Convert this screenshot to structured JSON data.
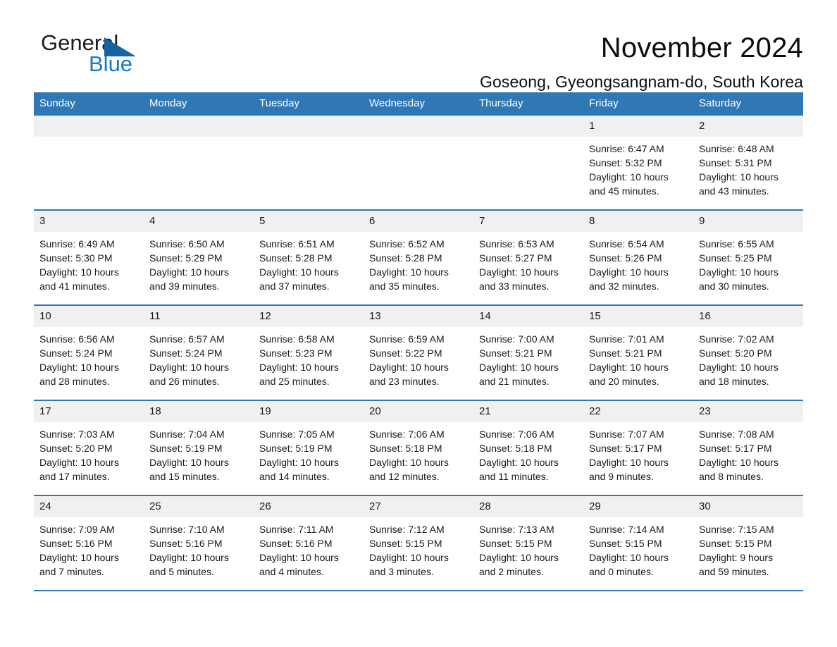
{
  "brand": {
    "name_part1": "General",
    "name_part2": "Blue",
    "triangle_color": "#1464a5",
    "blue_color": "#1479c4"
  },
  "header": {
    "title": "November 2024",
    "subtitle": "Goseong, Gyeongsangnam-do, South Korea"
  },
  "theme": {
    "header_blue": "#2f77b5",
    "daynum_band": "#f0f0f0",
    "row_divider": "#2f77b5"
  },
  "calendar": {
    "weekday_headers": [
      "Sunday",
      "Monday",
      "Tuesday",
      "Wednesday",
      "Thursday",
      "Friday",
      "Saturday"
    ],
    "weeks": [
      [
        {
          "day": "",
          "lines": []
        },
        {
          "day": "",
          "lines": []
        },
        {
          "day": "",
          "lines": []
        },
        {
          "day": "",
          "lines": []
        },
        {
          "day": "",
          "lines": []
        },
        {
          "day": "1",
          "lines": [
            "Sunrise: 6:47 AM",
            "Sunset: 5:32 PM",
            "Daylight: 10 hours",
            "and 45 minutes."
          ]
        },
        {
          "day": "2",
          "lines": [
            "Sunrise: 6:48 AM",
            "Sunset: 5:31 PM",
            "Daylight: 10 hours",
            "and 43 minutes."
          ]
        }
      ],
      [
        {
          "day": "3",
          "lines": [
            "Sunrise: 6:49 AM",
            "Sunset: 5:30 PM",
            "Daylight: 10 hours",
            "and 41 minutes."
          ]
        },
        {
          "day": "4",
          "lines": [
            "Sunrise: 6:50 AM",
            "Sunset: 5:29 PM",
            "Daylight: 10 hours",
            "and 39 minutes."
          ]
        },
        {
          "day": "5",
          "lines": [
            "Sunrise: 6:51 AM",
            "Sunset: 5:28 PM",
            "Daylight: 10 hours",
            "and 37 minutes."
          ]
        },
        {
          "day": "6",
          "lines": [
            "Sunrise: 6:52 AM",
            "Sunset: 5:28 PM",
            "Daylight: 10 hours",
            "and 35 minutes."
          ]
        },
        {
          "day": "7",
          "lines": [
            "Sunrise: 6:53 AM",
            "Sunset: 5:27 PM",
            "Daylight: 10 hours",
            "and 33 minutes."
          ]
        },
        {
          "day": "8",
          "lines": [
            "Sunrise: 6:54 AM",
            "Sunset: 5:26 PM",
            "Daylight: 10 hours",
            "and 32 minutes."
          ]
        },
        {
          "day": "9",
          "lines": [
            "Sunrise: 6:55 AM",
            "Sunset: 5:25 PM",
            "Daylight: 10 hours",
            "and 30 minutes."
          ]
        }
      ],
      [
        {
          "day": "10",
          "lines": [
            "Sunrise: 6:56 AM",
            "Sunset: 5:24 PM",
            "Daylight: 10 hours",
            "and 28 minutes."
          ]
        },
        {
          "day": "11",
          "lines": [
            "Sunrise: 6:57 AM",
            "Sunset: 5:24 PM",
            "Daylight: 10 hours",
            "and 26 minutes."
          ]
        },
        {
          "day": "12",
          "lines": [
            "Sunrise: 6:58 AM",
            "Sunset: 5:23 PM",
            "Daylight: 10 hours",
            "and 25 minutes."
          ]
        },
        {
          "day": "13",
          "lines": [
            "Sunrise: 6:59 AM",
            "Sunset: 5:22 PM",
            "Daylight: 10 hours",
            "and 23 minutes."
          ]
        },
        {
          "day": "14",
          "lines": [
            "Sunrise: 7:00 AM",
            "Sunset: 5:21 PM",
            "Daylight: 10 hours",
            "and 21 minutes."
          ]
        },
        {
          "day": "15",
          "lines": [
            "Sunrise: 7:01 AM",
            "Sunset: 5:21 PM",
            "Daylight: 10 hours",
            "and 20 minutes."
          ]
        },
        {
          "day": "16",
          "lines": [
            "Sunrise: 7:02 AM",
            "Sunset: 5:20 PM",
            "Daylight: 10 hours",
            "and 18 minutes."
          ]
        }
      ],
      [
        {
          "day": "17",
          "lines": [
            "Sunrise: 7:03 AM",
            "Sunset: 5:20 PM",
            "Daylight: 10 hours",
            "and 17 minutes."
          ]
        },
        {
          "day": "18",
          "lines": [
            "Sunrise: 7:04 AM",
            "Sunset: 5:19 PM",
            "Daylight: 10 hours",
            "and 15 minutes."
          ]
        },
        {
          "day": "19",
          "lines": [
            "Sunrise: 7:05 AM",
            "Sunset: 5:19 PM",
            "Daylight: 10 hours",
            "and 14 minutes."
          ]
        },
        {
          "day": "20",
          "lines": [
            "Sunrise: 7:06 AM",
            "Sunset: 5:18 PM",
            "Daylight: 10 hours",
            "and 12 minutes."
          ]
        },
        {
          "day": "21",
          "lines": [
            "Sunrise: 7:06 AM",
            "Sunset: 5:18 PM",
            "Daylight: 10 hours",
            "and 11 minutes."
          ]
        },
        {
          "day": "22",
          "lines": [
            "Sunrise: 7:07 AM",
            "Sunset: 5:17 PM",
            "Daylight: 10 hours",
            "and 9 minutes."
          ]
        },
        {
          "day": "23",
          "lines": [
            "Sunrise: 7:08 AM",
            "Sunset: 5:17 PM",
            "Daylight: 10 hours",
            "and 8 minutes."
          ]
        }
      ],
      [
        {
          "day": "24",
          "lines": [
            "Sunrise: 7:09 AM",
            "Sunset: 5:16 PM",
            "Daylight: 10 hours",
            "and 7 minutes."
          ]
        },
        {
          "day": "25",
          "lines": [
            "Sunrise: 7:10 AM",
            "Sunset: 5:16 PM",
            "Daylight: 10 hours",
            "and 5 minutes."
          ]
        },
        {
          "day": "26",
          "lines": [
            "Sunrise: 7:11 AM",
            "Sunset: 5:16 PM",
            "Daylight: 10 hours",
            "and 4 minutes."
          ]
        },
        {
          "day": "27",
          "lines": [
            "Sunrise: 7:12 AM",
            "Sunset: 5:15 PM",
            "Daylight: 10 hours",
            "and 3 minutes."
          ]
        },
        {
          "day": "28",
          "lines": [
            "Sunrise: 7:13 AM",
            "Sunset: 5:15 PM",
            "Daylight: 10 hours",
            "and 2 minutes."
          ]
        },
        {
          "day": "29",
          "lines": [
            "Sunrise: 7:14 AM",
            "Sunset: 5:15 PM",
            "Daylight: 10 hours",
            "and 0 minutes."
          ]
        },
        {
          "day": "30",
          "lines": [
            "Sunrise: 7:15 AM",
            "Sunset: 5:15 PM",
            "Daylight: 9 hours",
            "and 59 minutes."
          ]
        }
      ]
    ]
  }
}
